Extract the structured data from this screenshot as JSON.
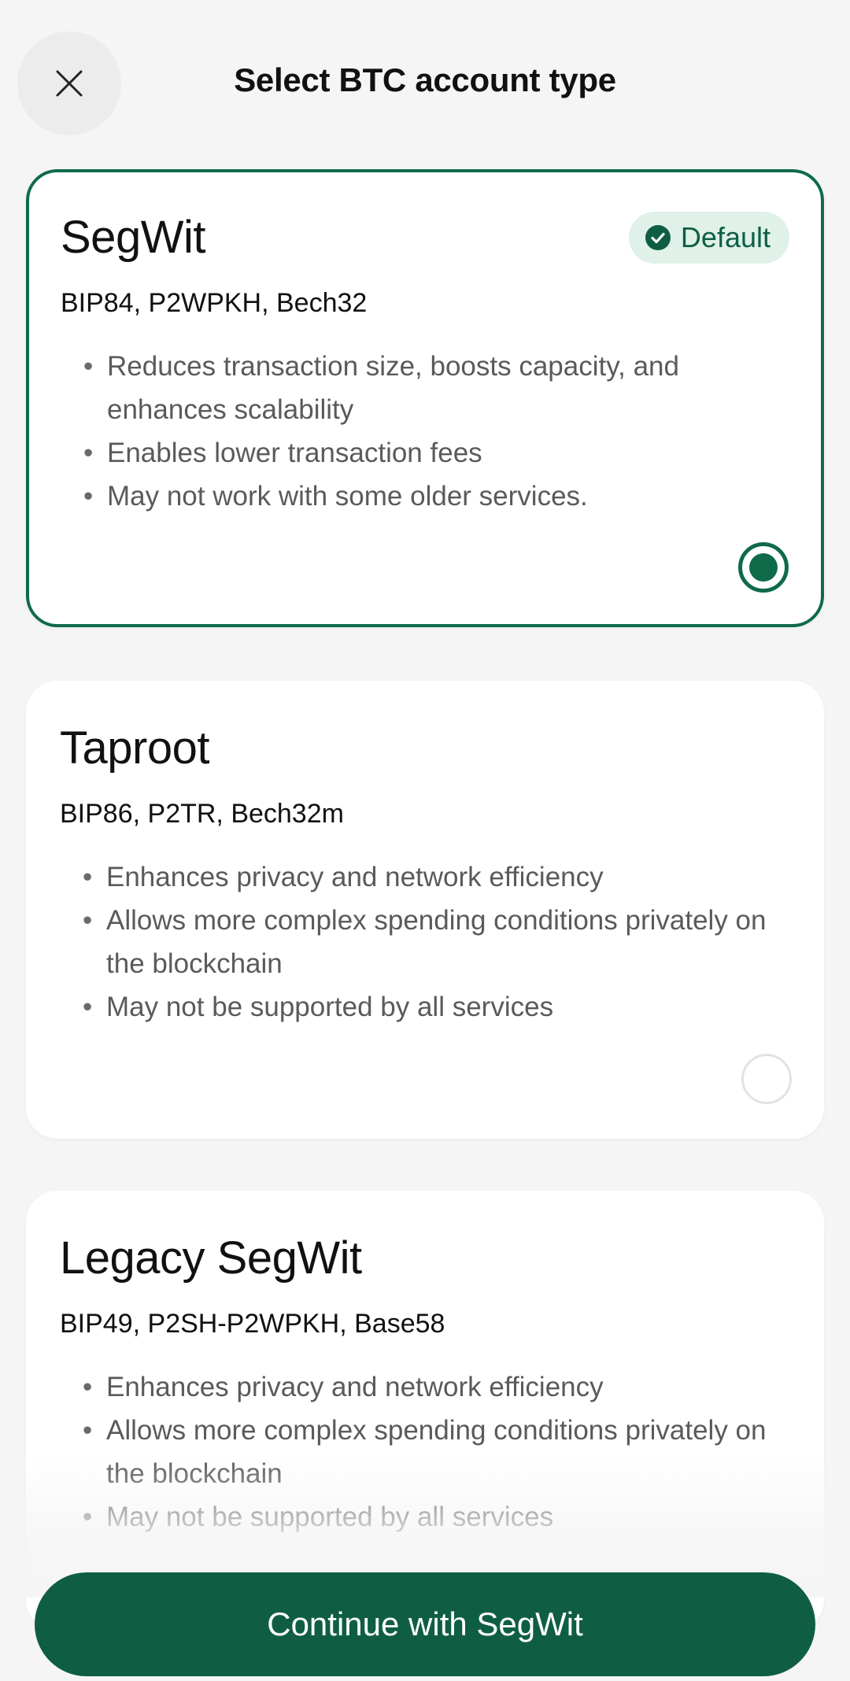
{
  "header": {
    "title": "Select BTC account type",
    "close_icon": "close-icon"
  },
  "options": [
    {
      "title": "SegWit",
      "subtitle": "BIP84, P2WPKH, Bech32",
      "badge": "Default",
      "selected": true,
      "bullets": [
        "Reduces transaction size, boosts capacity, and enhances scalability",
        "Enables lower transaction fees",
        "May not work with some older services."
      ]
    },
    {
      "title": "Taproot",
      "subtitle": "BIP86, P2TR, Bech32m",
      "selected": false,
      "bullets": [
        "Enhances privacy and network efficiency",
        "Allows more complex spending conditions privately on the blockchain",
        "May not be supported by all services"
      ]
    },
    {
      "title": "Legacy SegWit",
      "subtitle": "BIP49, P2SH-P2WPKH, Base58",
      "selected": false,
      "bullets": [
        "Enhances privacy and network efficiency",
        "Allows more complex spending conditions privately on the blockchain",
        "May not be supported by all services"
      ]
    }
  ],
  "bullet_char": "•",
  "footer": {
    "continue_label": "Continue with SegWit"
  },
  "colors": {
    "accent": "#0f6a4a",
    "button": "#0f5e43",
    "badge_bg": "#dff1e8",
    "background": "#f5f5f5"
  }
}
